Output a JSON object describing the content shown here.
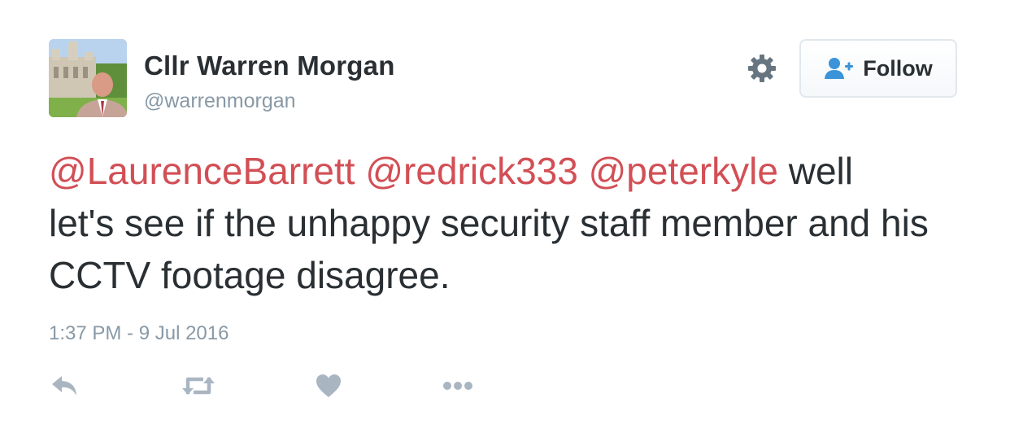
{
  "user": {
    "display_name": "Cllr Warren Morgan",
    "handle": "@warrenmorgan"
  },
  "header": {
    "settings_icon": "gear-icon",
    "follow_label": "Follow",
    "follow_icon": "add-user-icon"
  },
  "tweet": {
    "mentions": [
      "@LaurenceBarrett",
      "@redrick333",
      "@peterkyle"
    ],
    "text_line_1": "well",
    "text_rest": "let's see if the unhappy security staff member and his CCTV footage disagree.",
    "timestamp": "1:37 PM - 9 Jul 2016"
  },
  "actions": {
    "icons": [
      "reply-icon",
      "retweet-icon",
      "like-icon",
      "more-icon"
    ]
  },
  "colors": {
    "mention": "#d24f55",
    "text": "#292f33",
    "muted": "#8899a6",
    "icon": "#a9b6c2",
    "follow_icon": "#3b94d9"
  }
}
